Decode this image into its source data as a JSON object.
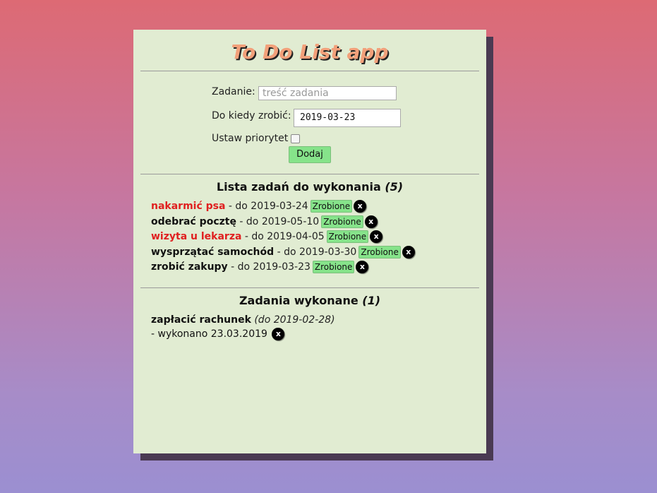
{
  "app": {
    "title": "To Do List app"
  },
  "form": {
    "task_label": "Zadanie:",
    "task_placeholder": "treść zadania",
    "deadline_label": "Do kiedy zrobić:",
    "deadline_value": "2019-03-23",
    "priority_label": "Ustaw priorytet",
    "priority_checked": false,
    "add_label": "Dodaj"
  },
  "active": {
    "title": "Lista zadań do wykonania",
    "count": "(5)",
    "tasks": [
      {
        "name": "nakarmić psa",
        "priority": true,
        "deadline": " - do 2019-03-24",
        "done_label": "Zrobione",
        "delete_label": "x"
      },
      {
        "name": "odebrać pocztę",
        "priority": false,
        "deadline": " - do 2019-05-10",
        "done_label": "Zrobione",
        "delete_label": "x"
      },
      {
        "name": "wizyta u lekarza",
        "priority": true,
        "deadline": " - do 2019-04-05",
        "done_label": "Zrobione",
        "delete_label": "x"
      },
      {
        "name": "wysprzątać samochód",
        "priority": false,
        "deadline": " - do 2019-03-30",
        "done_label": "Zrobione",
        "delete_label": "x"
      },
      {
        "name": "zrobić zakupy",
        "priority": false,
        "deadline": " - do 2019-03-23",
        "done_label": "Zrobione",
        "delete_label": "x"
      }
    ]
  },
  "completed": {
    "title": "Zadania wykonane",
    "count": "(1)",
    "tasks": [
      {
        "name": "zapłacić rachunek",
        "deadline": "(do 2019-02-28)",
        "completed_text": "- wykonano 23.03.2019",
        "delete_label": "x"
      }
    ]
  },
  "colors": {
    "card_bg": "#e1ecd2",
    "title": "#f2a07a",
    "priority": "#e02020",
    "button_green": "#86e38a"
  }
}
